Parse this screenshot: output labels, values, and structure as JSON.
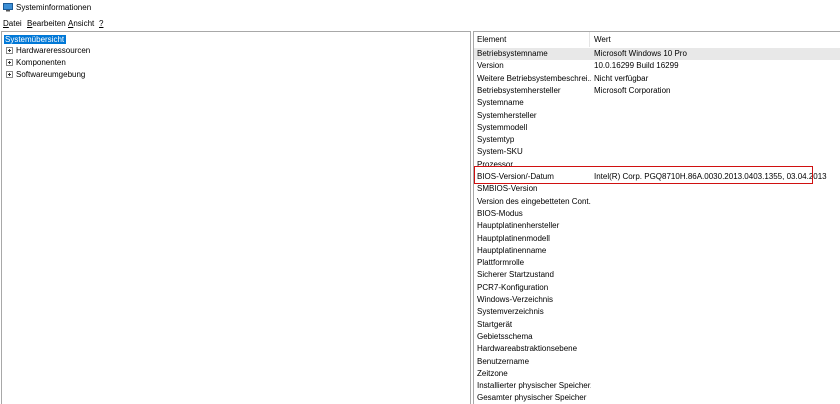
{
  "window": {
    "title": "Systeminformationen",
    "accent": "#0078d7",
    "highlight_color": "#d01010"
  },
  "menu": [
    {
      "label": "Datei",
      "u": "D",
      "rest": "atei"
    },
    {
      "label": "Bearbeiten",
      "u": "B",
      "rest": "earbeiten"
    },
    {
      "label": "Ansicht",
      "u": "A",
      "rest": "nsicht"
    },
    {
      "label": "?",
      "u": "?",
      "rest": ""
    }
  ],
  "tree": {
    "root": "Systemübersicht",
    "children": [
      "Hardwareressourcen",
      "Komponenten",
      "Softwareumgebung"
    ]
  },
  "list": {
    "columns": [
      "Element",
      "Wert"
    ],
    "rows": [
      {
        "element": "Betriebsystemname",
        "value": "Microsoft Windows 10 Pro"
      },
      {
        "element": "Version",
        "value": "10.0.16299 Build 16299"
      },
      {
        "element": "Weitere Betriebsystembeschrei...",
        "value": "Nicht verfügbar"
      },
      {
        "element": "Betriebsystemhersteller",
        "value": "Microsoft Corporation"
      },
      {
        "element": "Systemname",
        "value": ""
      },
      {
        "element": "Systemhersteller",
        "value": ""
      },
      {
        "element": "Systemmodell",
        "value": ""
      },
      {
        "element": "Systemtyp",
        "value": ""
      },
      {
        "element": "System-SKU",
        "value": ""
      },
      {
        "element": "Prozessor",
        "value": ""
      },
      {
        "element": "BIOS-Version/-Datum",
        "value": "Intel(R) Corp. PGQ8710H.86A.0030.2013.0403.1355, 03.04.2013"
      },
      {
        "element": "SMBIOS-Version",
        "value": ""
      },
      {
        "element": "Version des eingebetteten Cont...",
        "value": ""
      },
      {
        "element": "BIOS-Modus",
        "value": ""
      },
      {
        "element": "Hauptplatinenhersteller",
        "value": ""
      },
      {
        "element": "Hauptplatinenmodell",
        "value": ""
      },
      {
        "element": "Hauptplatinenname",
        "value": ""
      },
      {
        "element": "Plattformrolle",
        "value": ""
      },
      {
        "element": "Sicherer Startzustand",
        "value": ""
      },
      {
        "element": "PCR7-Konfiguration",
        "value": ""
      },
      {
        "element": "Windows-Verzeichnis",
        "value": ""
      },
      {
        "element": "Systemverzeichnis",
        "value": ""
      },
      {
        "element": "Startgerät",
        "value": ""
      },
      {
        "element": "Gebietsschema",
        "value": ""
      },
      {
        "element": "Hardwareabstraktionsebene",
        "value": ""
      },
      {
        "element": "Benutzername",
        "value": ""
      },
      {
        "element": "Zeitzone",
        "value": ""
      },
      {
        "element": "Installierter physischer Speicher...",
        "value": ""
      },
      {
        "element": "Gesamter physischer Speicher",
        "value": ""
      }
    ]
  }
}
